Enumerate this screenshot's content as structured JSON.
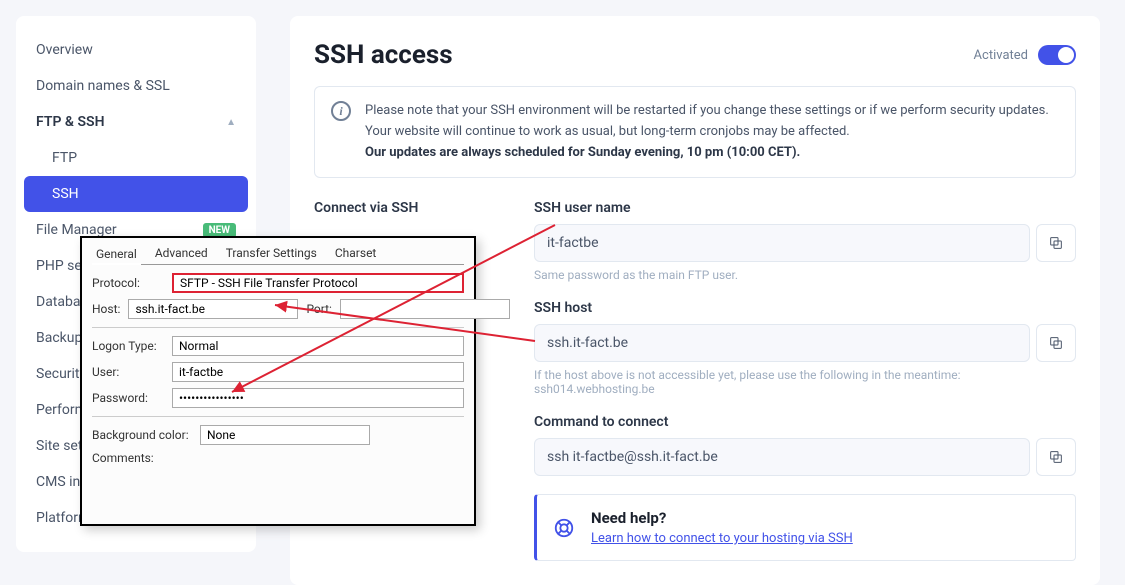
{
  "sidebar": {
    "items": [
      {
        "label": "Overview"
      },
      {
        "label": "Domain names & SSL"
      },
      {
        "label": "FTP & SSH"
      },
      {
        "label": "FTP"
      },
      {
        "label": "SSH"
      },
      {
        "label": "File Manager",
        "badge": "NEW"
      },
      {
        "label": "PHP settings"
      },
      {
        "label": "Databases"
      },
      {
        "label": "Backups"
      },
      {
        "label": "Security"
      },
      {
        "label": "Performance"
      },
      {
        "label": "Site settings"
      },
      {
        "label": "CMS install"
      },
      {
        "label": "Platform"
      }
    ]
  },
  "main": {
    "title": "SSH access",
    "activated": "Activated",
    "info": {
      "line": "Please note that your SSH environment will be restarted if you change these settings or if we perform security updates. Your website will continue to work as usual, but long-term cronjobs may be affected.",
      "bold": "Our updates are always scheduled for Sunday evening, 10 pm (10:00 CET)."
    },
    "connect_label": "Connect via SSH",
    "username_label": "SSH user name",
    "username": "it-factbe",
    "username_hint": "Same password as the main FTP user.",
    "host_label": "SSH host",
    "host": "ssh.it-fact.be",
    "host_hint": "If the host above is not accessible yet, please use the following in the meantime: ssh014.webhosting.be",
    "command_label": "Command to connect",
    "command": "ssh it-factbe@ssh.it-fact.be",
    "help": {
      "title": "Need help?",
      "link": "Learn how to connect to your hosting via SSH"
    }
  },
  "dialog": {
    "tabs": [
      "General",
      "Advanced",
      "Transfer Settings",
      "Charset"
    ],
    "protocol_label": "Protocol:",
    "protocol": "SFTP - SSH File Transfer Protocol",
    "host_label": "Host:",
    "host": "ssh.it-fact.be",
    "port_label": "Port:",
    "port": "",
    "logon_label": "Logon Type:",
    "logon": "Normal",
    "user_label": "User:",
    "user": "it-factbe",
    "password_label": "Password:",
    "password": "••••••••••••••••",
    "bg_label": "Background color:",
    "bg": "None",
    "comments_label": "Comments:"
  }
}
